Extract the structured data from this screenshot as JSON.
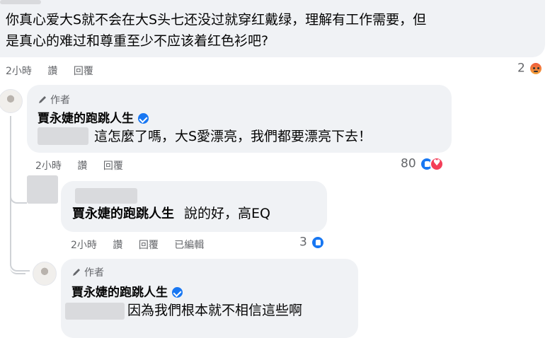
{
  "comment1": {
    "text_line1": "你真心爱大S就不会在大S头七还没过就穿红戴绿，理解有工作需要，但",
    "text_line2": "是真心的难过和尊重至少不应该着红色衫吧?",
    "time": "2小時",
    "like_label": "讚",
    "reply_label": "回覆",
    "reaction_count": "2"
  },
  "reply1": {
    "author_tag": "作者",
    "name": "賈永婕的跑跳人生",
    "text": "這怎麼了嗎，大S愛漂亮，我們都要漂亮下去！",
    "time": "2小時",
    "like_label": "讚",
    "reply_label": "回覆",
    "reaction_count": "80"
  },
  "reply2": {
    "name": "賈永婕的跑跳人生",
    "text": "說的好，高EQ",
    "time": "2小時",
    "like_label": "讚",
    "reply_label": "回覆",
    "edited_label": "已編輯",
    "reaction_count": "3"
  },
  "reply3": {
    "author_tag": "作者",
    "name": "賈永婕的跑跳人生",
    "text": "因為我們根本就不相信這些啊"
  },
  "colors": {
    "bubble": "#f0f2f5",
    "meta": "#65676b",
    "like_blue": "#1877f2",
    "love_red": "#f33e58"
  }
}
